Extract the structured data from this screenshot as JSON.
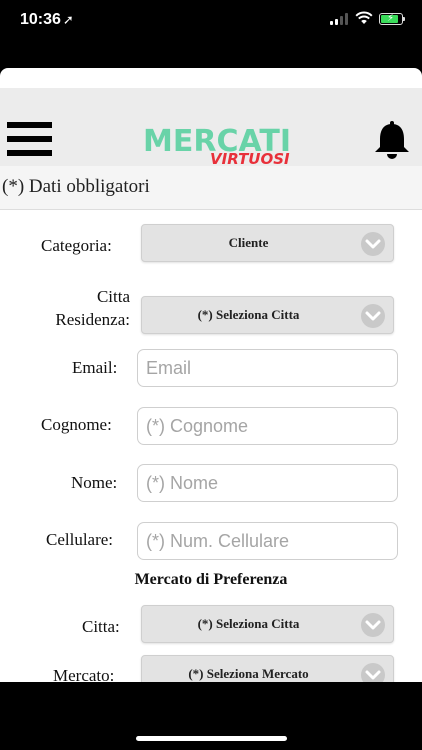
{
  "status_bar": {
    "time": "10:36",
    "location_glyph": "➚",
    "battery_color": "#3adb5a"
  },
  "header": {
    "logo_main": "MERCATI",
    "logo_sub": "VIRTUOSI",
    "logo_main_color": "#69d3a8",
    "logo_sub_color": "#e8303a",
    "menu_icon": "hamburger-menu-icon",
    "notification_icon": "bell-icon"
  },
  "form": {
    "required_note": "(*) Dati obbligatori",
    "categoria": {
      "label": "Categoria:",
      "value": "Cliente"
    },
    "citta_residenza": {
      "label_line1": "Citta",
      "label_line2": "Residenza:",
      "value": "(*) Seleziona Citta"
    },
    "email": {
      "label": "Email:",
      "placeholder": "Email"
    },
    "cognome": {
      "label": "Cognome:",
      "placeholder": "(*) Cognome"
    },
    "nome": {
      "label": "Nome:",
      "placeholder": "(*) Nome"
    },
    "cellulare": {
      "label": "Cellulare:",
      "placeholder": "(*) Num. Cellulare"
    },
    "section_title": "Mercato di Preferenza",
    "citta": {
      "label": "Citta:",
      "value": "(*) Seleziona Citta"
    },
    "mercato": {
      "label": "Mercato:",
      "value": "(*) Seleziona Mercato"
    }
  }
}
